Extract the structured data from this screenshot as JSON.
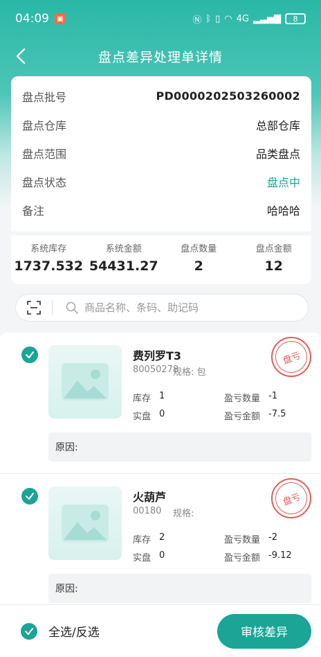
{
  "status_bar": {
    "time": "04:09",
    "battery": "8",
    "signal_text": "4G"
  },
  "header": {
    "title": "盘点差异处理单详情"
  },
  "info": {
    "batch_label": "盘点批号",
    "batch_value": "PD0000202503260002",
    "warehouse_label": "盘点仓库",
    "warehouse_value": "总部仓库",
    "scope_label": "盘点范围",
    "scope_value": "品类盘点",
    "status_label": "盘点状态",
    "status_value": "盘点中",
    "remark_label": "备注",
    "remark_value": "哈哈哈"
  },
  "stats": [
    {
      "label": "系统库存",
      "value": "1737.532"
    },
    {
      "label": "系统金额",
      "value": "54431.27"
    },
    {
      "label": "盘点数量",
      "value": "2"
    },
    {
      "label": "盘点金额",
      "value": "12"
    }
  ],
  "search": {
    "placeholder": "商品名称、条码、助记码"
  },
  "items": [
    {
      "name": "费列罗T3",
      "code": "80050278",
      "spec": "规格:  包",
      "stock_label": "库存",
      "stock": "1",
      "actual_label": "实盘",
      "actual": "0",
      "diff_qty_label": "盈亏数量",
      "diff_qty": "-1",
      "diff_amt_label": "盈亏金额",
      "diff_amt": "-7.5",
      "stamp": "盘亏",
      "reason": "原因:"
    },
    {
      "name": "火葫芦",
      "code": "00180",
      "spec": "规格:",
      "stock_label": "库存",
      "stock": "2",
      "actual_label": "实盘",
      "actual": "0",
      "diff_qty_label": "盈亏数量",
      "diff_qty": "-2",
      "diff_amt_label": "盈亏金额",
      "diff_amt": "-9.12",
      "stamp": "盘亏",
      "reason": "原因:"
    }
  ],
  "footer": {
    "select_all_label": "全选/反选",
    "audit_button": "审核差异"
  },
  "colors": {
    "accent": "#1aa596",
    "stamp": "#e55a55"
  }
}
